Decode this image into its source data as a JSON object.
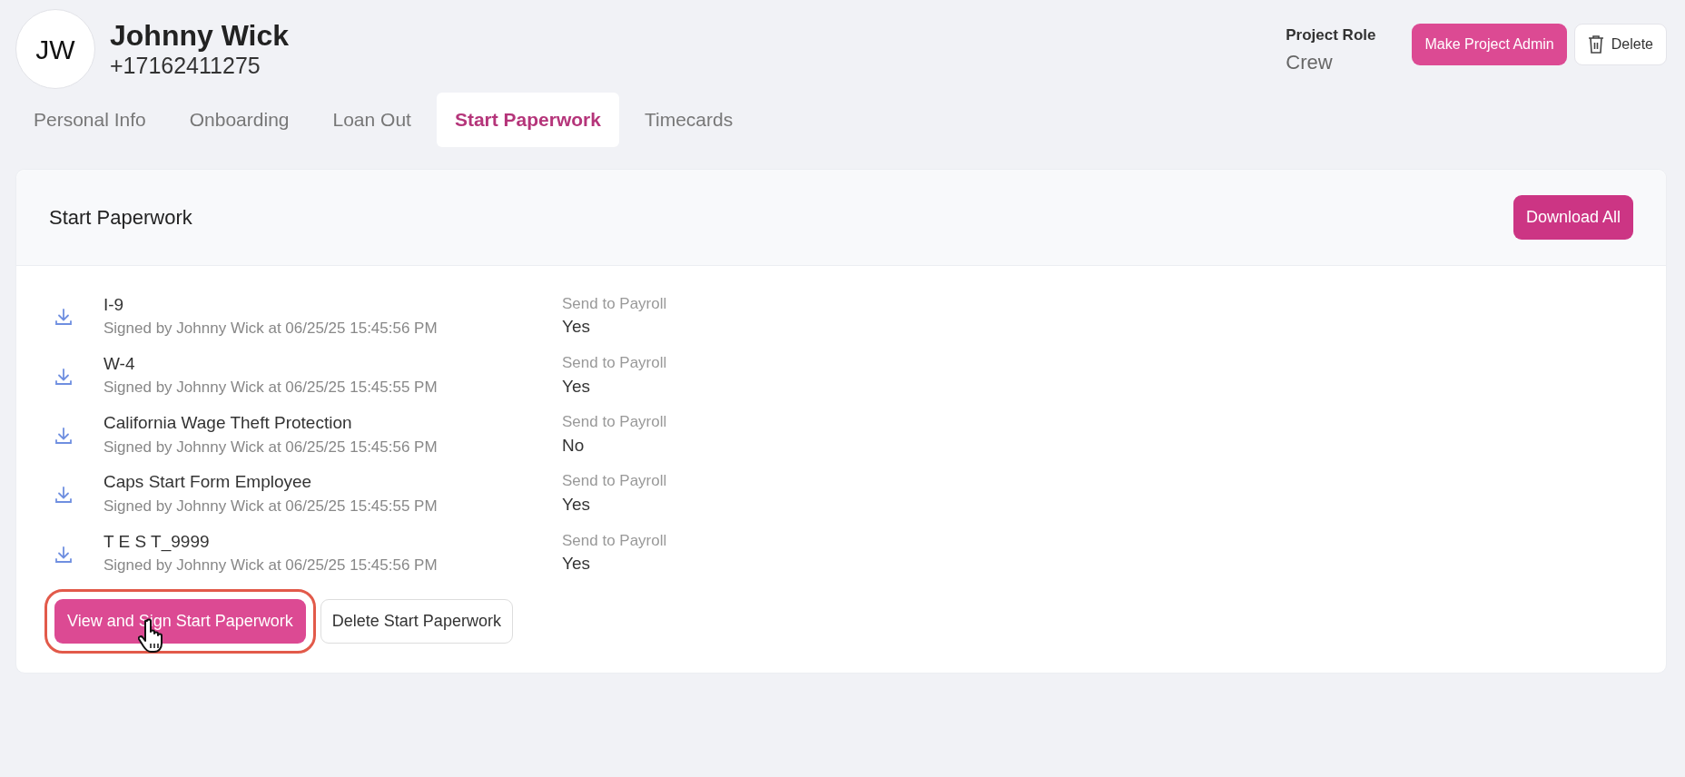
{
  "profile": {
    "initials": "JW",
    "name": "Johnny Wick",
    "phone": "+17162411275"
  },
  "role": {
    "label": "Project Role",
    "value": "Crew"
  },
  "header_buttons": [
    {
      "label": "Make Project Admin",
      "kind": "primary"
    },
    {
      "label": "Delete",
      "kind": "delete"
    }
  ],
  "tabs": [
    {
      "label": "Personal Info",
      "selected": false
    },
    {
      "label": "Onboarding",
      "selected": false
    },
    {
      "label": "Loan Out",
      "selected": false
    },
    {
      "label": "Start Paperwork",
      "selected": true
    },
    {
      "label": "Timecards",
      "selected": false
    }
  ],
  "card": {
    "title": "Start Paperwork",
    "action": "Download All",
    "documents": [
      {
        "name": "I-9",
        "signed": "Signed by Johnny Wick at 06/25/25 15:45:56 PM",
        "payroll_label": "Send to Payroll",
        "payroll_value": "Yes"
      },
      {
        "name": "W-4",
        "signed": "Signed by Johnny Wick at 06/25/25 15:45:55 PM",
        "payroll_label": "Send to Payroll",
        "payroll_value": "Yes"
      },
      {
        "name": "California Wage Theft Protection",
        "signed": "Signed by Johnny Wick at 06/25/25 15:45:56 PM",
        "payroll_label": "Send to Payroll",
        "payroll_value": "No"
      },
      {
        "name": "Caps Start Form Employee",
        "signed": "Signed by Johnny Wick at 06/25/25 15:45:55 PM",
        "payroll_label": "Send to Payroll",
        "payroll_value": "Yes"
      },
      {
        "name": "T E S T_9999",
        "signed": "Signed by Johnny Wick at 06/25/25 15:45:56 PM",
        "payroll_label": "Send to Payroll",
        "payroll_value": "Yes"
      }
    ],
    "footer_buttons": [
      {
        "label": "View and Sign Start Paperwork",
        "kind": "primary",
        "highlighted": true
      },
      {
        "label": "Delete Start Paperwork",
        "kind": "outline",
        "highlighted": false
      }
    ]
  }
}
